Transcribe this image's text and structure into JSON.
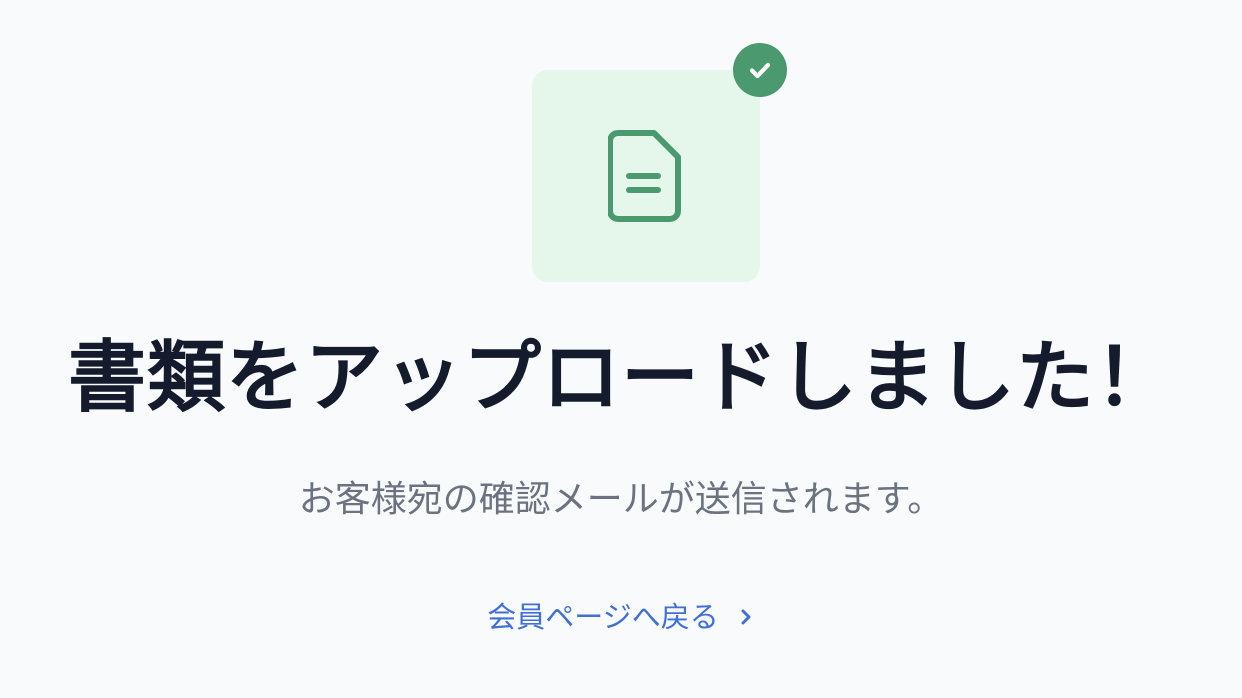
{
  "status": {
    "title": "書類をアップロードしました！",
    "subtitle": "お客様宛の確認メールが送信されます。"
  },
  "actions": {
    "back_link": "会員ページへ戻る"
  },
  "icons": {
    "document": "document-icon",
    "check": "check-icon",
    "chevron": "chevron-right-icon"
  },
  "colors": {
    "tile_bg": "#e5f6ea",
    "icon_green": "#4b9a6f",
    "title": "#141b2d",
    "subtitle": "#6b7280",
    "link": "#3f6fd8",
    "page_bg": "#f8fafc"
  }
}
